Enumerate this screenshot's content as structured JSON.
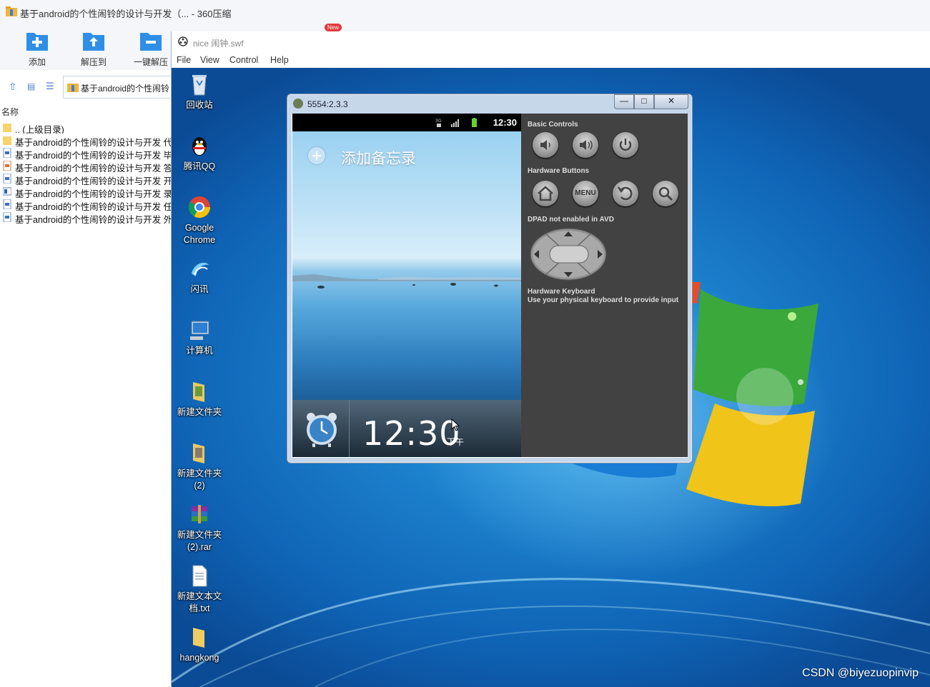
{
  "zip_app": {
    "title": "基于android的个性闹铃的设计与开发（... - 360压缩",
    "toolbar": [
      "添加",
      "解压到",
      "一键解压"
    ],
    "path": "基于android的个性闹铃",
    "column_name": "名称",
    "files": [
      {
        "name": ".. (上级目录)",
        "icon": "folder-icon"
      },
      {
        "name": "基于android的个性闹铃的设计与开发 代",
        "icon": "folder-icon"
      },
      {
        "name": "基于android的个性闹铃的设计与开发 毕",
        "icon": "word-doc-icon"
      },
      {
        "name": "基于android的个性闹铃的设计与开发 答",
        "icon": "ppt-icon"
      },
      {
        "name": "基于android的个性闹铃的设计与开发 开",
        "icon": "word-doc-icon"
      },
      {
        "name": "基于android的个性闹铃的设计与开发 录",
        "icon": "video-icon"
      },
      {
        "name": "基于android的个性闹铃的设计与开发 任",
        "icon": "word-doc-icon"
      },
      {
        "name": "基于android的个性闹铃的设计与开发 外",
        "icon": "word-doc-icon"
      }
    ],
    "badge_new": "New"
  },
  "flash_player": {
    "title": "nice 闹钟.swf",
    "menu": [
      "File",
      "View",
      "Control",
      "Help"
    ]
  },
  "desktop": {
    "icons": [
      "回收站",
      "腾讯QQ",
      "Google Chrome",
      "闪讯",
      "计算机",
      "新建文件夹",
      "新建文件夹 (2)",
      "新建文件夹 (2).rar",
      "新建文本文 档.txt",
      "hangkong"
    ],
    "watermark": "CSDN @biyezuopinvip"
  },
  "emulator": {
    "title": "5554:2.3.3",
    "status_time": "12:30",
    "memo_label": "添加备忘录",
    "widget_time": "12:30",
    "widget_ampm": "下午",
    "basic_controls": "Basic Controls",
    "hardware_buttons": "Hardware Buttons",
    "menu_button": "MENU",
    "dpad_notice": "DPAD not enabled in AVD",
    "keyboard_title": "Hardware Keyboard",
    "keyboard_hint": "Use your physical keyboard to provide input"
  },
  "colors": {
    "zip_blue": "#2f8ee5",
    "android_panel": "#424242",
    "desktop_blue": "#1676cc"
  }
}
